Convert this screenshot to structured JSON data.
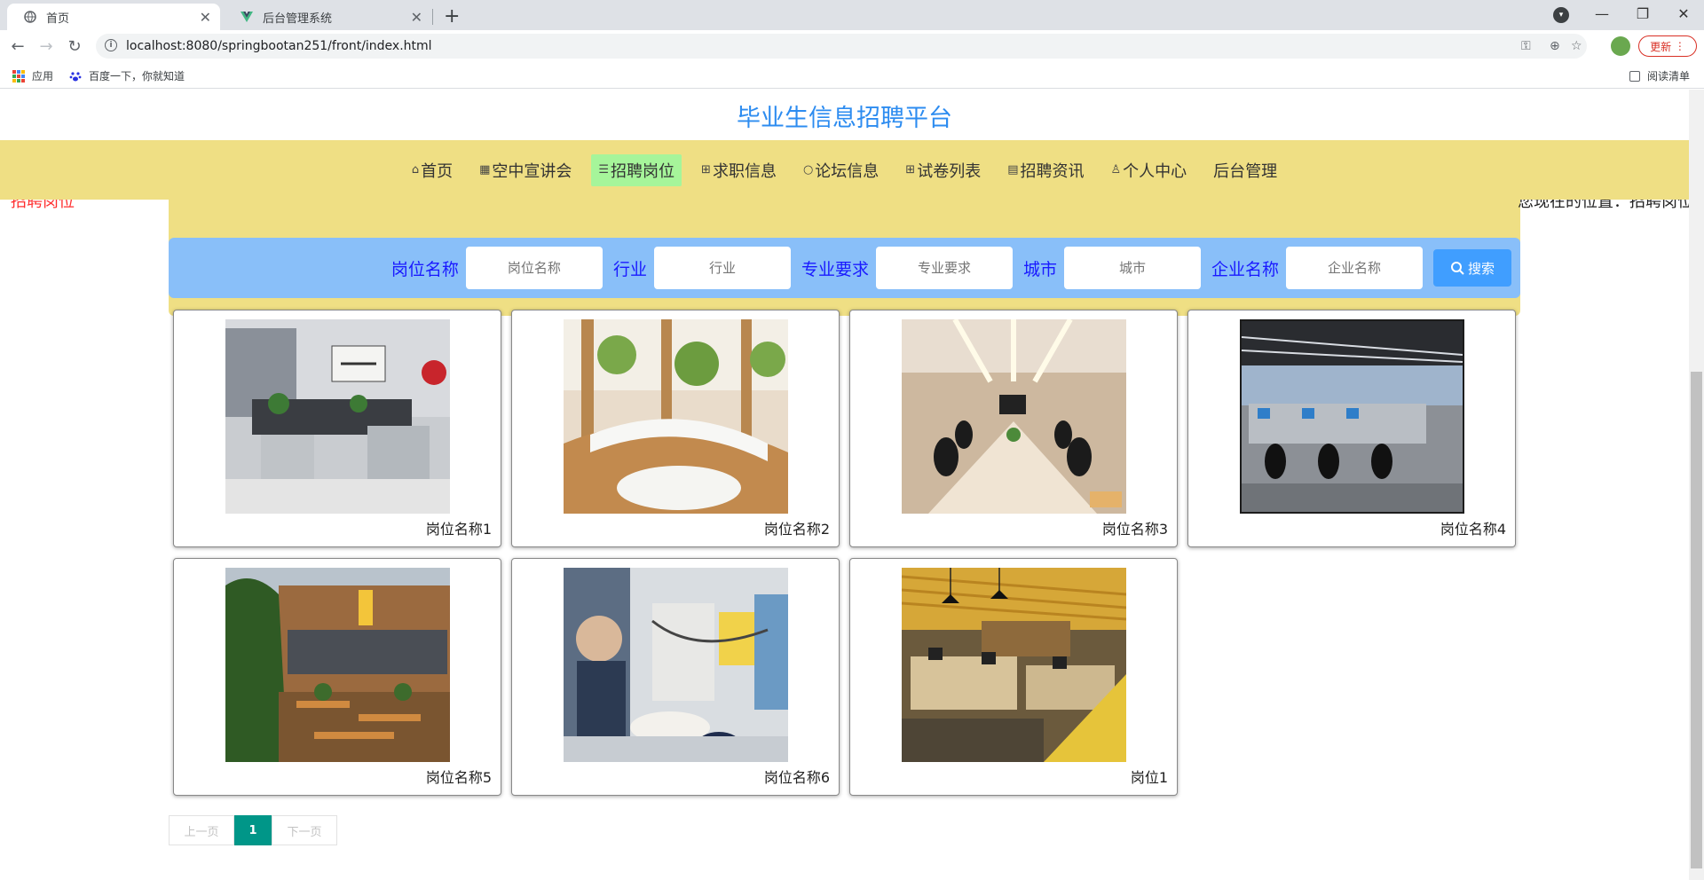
{
  "browser": {
    "tabs": [
      {
        "title": "首页",
        "active": true
      },
      {
        "title": "后台管理系统",
        "active": false
      }
    ],
    "url": "localhost:8080/springbootan251/front/index.html",
    "update_label": "更新",
    "bookmarks": [
      {
        "label": "应用"
      },
      {
        "label": "百度一下，你就知道"
      }
    ],
    "reading_list": "阅读清单"
  },
  "site": {
    "title": "毕业生信息招聘平台",
    "nav": [
      {
        "label": "首页",
        "icon": "home-icon",
        "glyph": "⌂",
        "active": false
      },
      {
        "label": "空中宣讲会",
        "icon": "grid-icon",
        "glyph": "▦",
        "active": false
      },
      {
        "label": "招聘岗位",
        "icon": "sliders-icon",
        "glyph": "☰",
        "active": true
      },
      {
        "label": "求职信息",
        "icon": "gift-icon",
        "glyph": "⊞",
        "active": false
      },
      {
        "label": "论坛信息",
        "icon": "circle-icon",
        "glyph": "○",
        "active": false
      },
      {
        "label": "试卷列表",
        "icon": "apps-icon",
        "glyph": "⊞",
        "active": false
      },
      {
        "label": "招聘资讯",
        "icon": "document-icon",
        "glyph": "▤",
        "active": false
      },
      {
        "label": "个人中心",
        "icon": "user-icon",
        "glyph": "♙",
        "active": false
      },
      {
        "label": "后台管理",
        "icon": "",
        "glyph": "",
        "active": false
      }
    ]
  },
  "breadcrumb": {
    "section": "招聘岗位",
    "location": "您现在的位置：招聘岗位"
  },
  "search": {
    "fields": [
      {
        "label": "岗位名称",
        "placeholder": "岗位名称"
      },
      {
        "label": "行业",
        "placeholder": "行业"
      },
      {
        "label": "专业要求",
        "placeholder": "专业要求"
      },
      {
        "label": "城市",
        "placeholder": "城市"
      },
      {
        "label": "企业名称",
        "placeholder": "企业名称"
      }
    ],
    "button_label": "搜索"
  },
  "jobs": [
    {
      "title": "岗位名称1"
    },
    {
      "title": "岗位名称2"
    },
    {
      "title": "岗位名称3"
    },
    {
      "title": "岗位名称4"
    },
    {
      "title": "岗位名称5"
    },
    {
      "title": "岗位名称6"
    },
    {
      "title": "岗位1"
    }
  ],
  "pager": {
    "prev": "上一页",
    "current": "1",
    "next": "下一页"
  },
  "colors": {
    "title": "#2d8cf0",
    "nav_bg": "#efdf84",
    "nav_active": "#a6f59a",
    "search_bg": "#89bff9",
    "search_label": "#1a1aff",
    "search_button": "#409eff",
    "pager_current": "#009688"
  }
}
